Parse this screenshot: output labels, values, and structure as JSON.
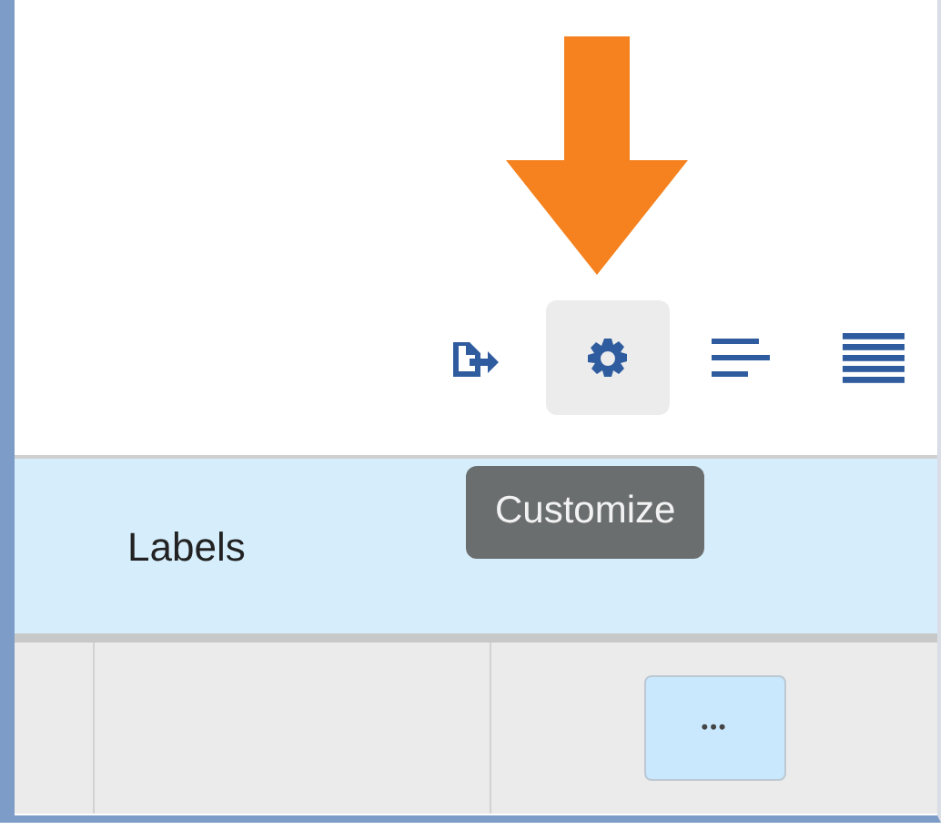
{
  "toolbar": [
    {
      "kind": "export",
      "hovered": false
    },
    {
      "kind": "settings",
      "hovered": true
    },
    {
      "kind": "compact",
      "hovered": false
    },
    {
      "kind": "dense",
      "hovered": false
    }
  ],
  "tooltip": "Customize",
  "table": {
    "header": "Labels",
    "rows": [
      {
        "action": "•••"
      }
    ]
  }
}
